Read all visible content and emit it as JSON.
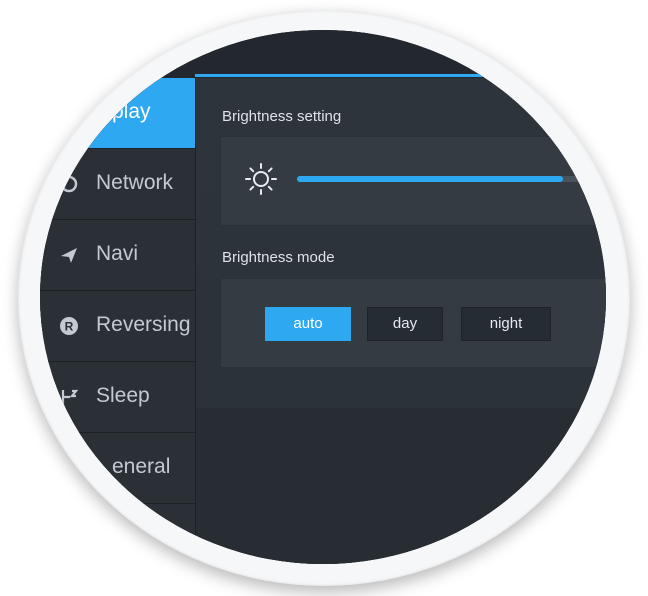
{
  "sidebar": {
    "items": [
      {
        "label": "play",
        "icon": "display-icon",
        "active": true
      },
      {
        "label": "Network",
        "icon": "network-icon",
        "active": false
      },
      {
        "label": "Navi",
        "icon": "navigation-arrow-icon",
        "active": false
      },
      {
        "label": "Reversing",
        "icon": "reversing-icon",
        "active": false
      },
      {
        "label": "Sleep",
        "icon": "sleep-icon",
        "active": false
      },
      {
        "label": "eneral",
        "icon": "general-icon",
        "active": false
      }
    ]
  },
  "brightness": {
    "title": "Brightness setting",
    "icon": "sun-icon",
    "level": 0.74
  },
  "mode": {
    "title": "Brightness mode",
    "options": [
      "auto",
      "day",
      "night"
    ],
    "selected": "auto"
  },
  "colors": {
    "accent": "#2ea8f0",
    "background": "#2e353c",
    "panel": "#343b43",
    "text": "#c4cad1"
  }
}
